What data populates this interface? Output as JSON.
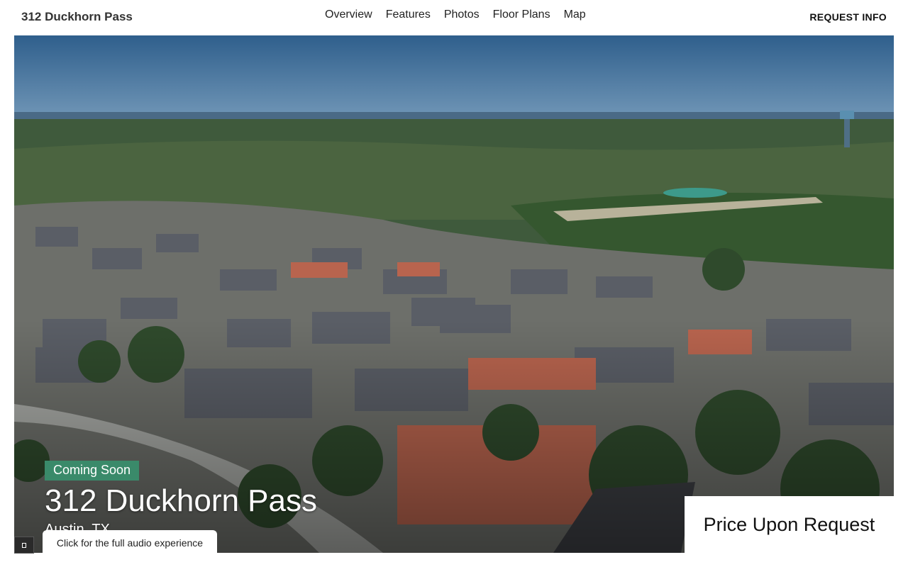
{
  "header": {
    "brand": "312 Duckhorn Pass",
    "nav": [
      "Overview",
      "Features",
      "Photos",
      "Floor Plans",
      "Map"
    ],
    "cta_label": "REQUEST INFO"
  },
  "hero": {
    "status_badge": "Coming Soon",
    "title": "312 Duckhorn Pass",
    "subtitle": "Austin, TX",
    "price": "Price Upon Request",
    "audio_hint": "Click for the full audio experience",
    "audio_icon": "sound-toggle-icon"
  },
  "colors": {
    "badge": "#3a8a6a",
    "sky": "#3f6f9a",
    "foliage": "#3b5a3a"
  }
}
